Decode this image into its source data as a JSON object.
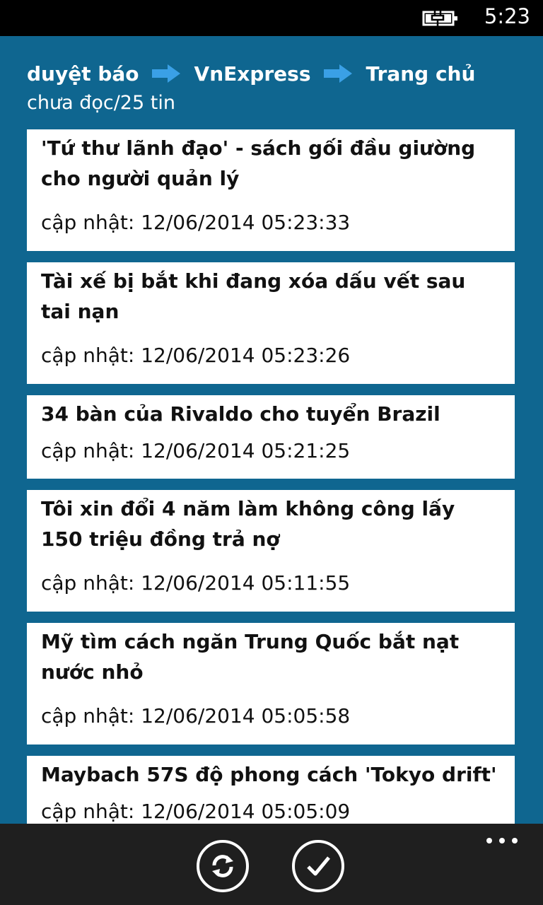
{
  "status": {
    "time": "5:23"
  },
  "header": {
    "breadcrumb": [
      "duyệt báo",
      "VnExpress",
      "Trang chủ"
    ],
    "subtitle": "chưa đọc/25 tin"
  },
  "articles": [
    {
      "title": "'Tứ thư lãnh đạo' - sách gối đầu giường cho người quản lý",
      "updated": "cập nhật: 12/06/2014 05:23:33"
    },
    {
      "title": "Tài xế bị bắt khi đang xóa dấu vết sau tai nạn",
      "updated": "cập nhật: 12/06/2014 05:23:26"
    },
    {
      "title": "34 bàn của Rivaldo cho tuyển Brazil",
      "updated": "cập nhật: 12/06/2014 05:21:25"
    },
    {
      "title": "Tôi xin đổi 4 năm làm không công lấy 150 triệu đồng trả nợ",
      "updated": "cập nhật: 12/06/2014 05:11:55"
    },
    {
      "title": "Mỹ tìm cách ngăn Trung Quốc bắt nạt nước nhỏ",
      "updated": "cập nhật: 12/06/2014 05:05:58"
    },
    {
      "title": "Maybach 57S độ phong cách 'Tokyo drift'",
      "updated": "cập nhật: 12/06/2014 05:05:09"
    }
  ],
  "app_bar": {
    "buttons": [
      "refresh-icon",
      "check-icon"
    ],
    "more": "ellipsis-icon"
  },
  "colors": {
    "background": "#0f6690",
    "accent_arrow": "#3aa0e6",
    "app_bar": "#1f1f1f"
  }
}
